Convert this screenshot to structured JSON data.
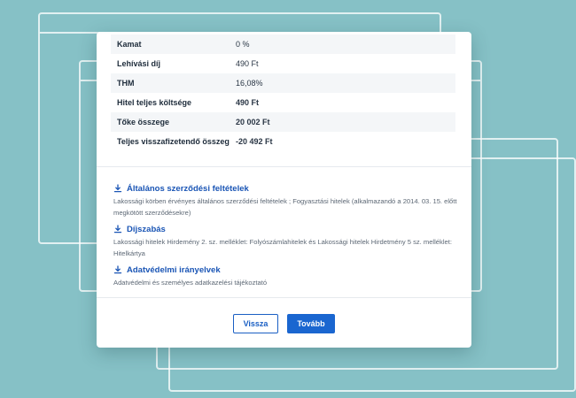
{
  "summary_rows": [
    {
      "label": "Kamat",
      "value": "0 %",
      "strong": false
    },
    {
      "label": "Lehívási díj",
      "value": "490 Ft",
      "strong": false
    },
    {
      "label": "THM",
      "value": "16,08%",
      "strong": false
    },
    {
      "label": "Hitel teljes költsége",
      "value": "490 Ft",
      "strong": true
    },
    {
      "label": "Tőke összege",
      "value": "20 002 Ft",
      "strong": true
    },
    {
      "label": "Teljes visszafizetendő összeg",
      "value": "-20 492 Ft",
      "strong": true
    }
  ],
  "documents": [
    {
      "title": "Általános szerződési feltételek",
      "description": "Lakossági körben érvényes általános szerződési feltételek ; Fogyasztási hitelek (alkalmazandó a 2014. 03. 15. előtt megkötött szerződésekre)"
    },
    {
      "title": "Díjszabás",
      "description": "Lakossági hitelek Hirdemény 2. sz. melléklet: Folyószámlahitelek és Lakossági hitelek Hirdetmény 5 sz. melléklet: Hitelkártya"
    },
    {
      "title": "Adatvédelmi irányelvek",
      "description": "Adatvédelmi és személyes adatkazelési tájékoztató"
    }
  ],
  "buttons": {
    "back_label": "Vissza",
    "next_label": "Tovább"
  },
  "colors": {
    "background": "#86c1c6",
    "link": "#1a55b5",
    "primary": "#1a66d0"
  },
  "icons": {
    "document_link": "download-icon"
  }
}
